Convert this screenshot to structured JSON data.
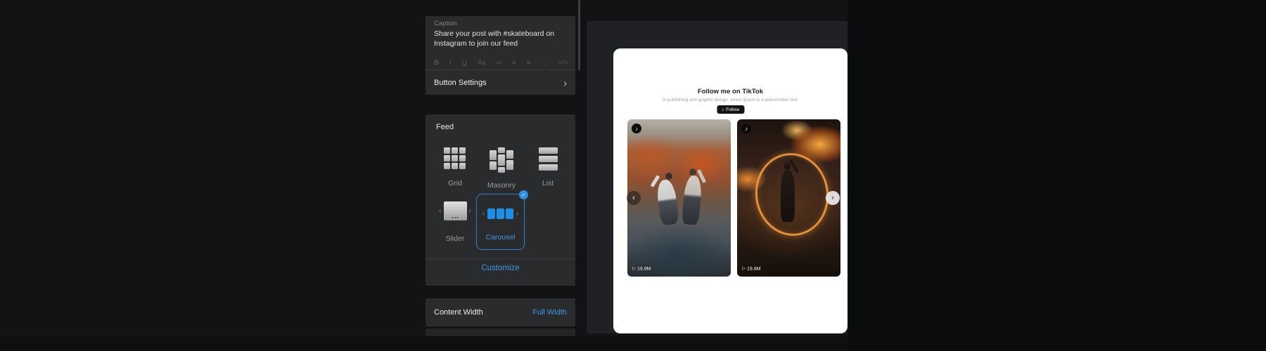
{
  "colors": {
    "accent_blue": "#3e97e8",
    "selected_border": "#2e7fd0",
    "panel_bg": "#2a2b2d",
    "preview_bg": "#202124",
    "page_bg": "#121314",
    "card_bg": "#ffffff",
    "follow_button_bg": "#141414"
  },
  "glyphs": {
    "check": "✓",
    "chevron_right": "›",
    "chevron_left": "‹",
    "play": "▷",
    "note": "♪"
  },
  "sidebar": {
    "caption": {
      "label": "Caption",
      "text": "Share your post with #skateboard on Instagram to join our feed",
      "toolbar": [
        "B",
        "I",
        "U",
        "Aa",
        "∞",
        "≡",
        "≡",
        "…",
        "</>"
      ]
    },
    "button_settings": {
      "label": "Button Settings"
    },
    "feed": {
      "label": "Feed",
      "layouts": [
        {
          "label": "Grid",
          "selected": false
        },
        {
          "label": "Masonry",
          "selected": false
        },
        {
          "label": "List",
          "selected": false
        },
        {
          "label": "Slider",
          "selected": false
        },
        {
          "label": "Carousel",
          "selected": true
        }
      ],
      "customize": "Customize"
    },
    "content_width": {
      "label": "Content Width",
      "value": "Full Width"
    }
  },
  "preview": {
    "title": "Follow me on TikTok",
    "subtitle": "In publishing and graphic design, lorem ipsum is a placeholder text.",
    "follow_button": "Follow",
    "videos": [
      {
        "views": "19.9M"
      },
      {
        "views": "19.8M"
      }
    ]
  }
}
